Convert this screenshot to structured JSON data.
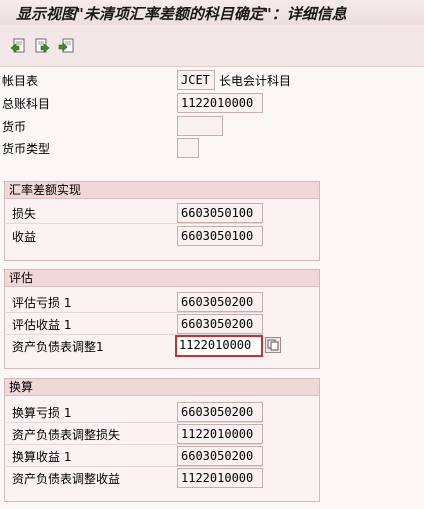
{
  "window": {
    "title": "显示视图\"未清项汇率差额的科目确定\"：详细信息"
  },
  "toolbar": {
    "buttons": [
      {
        "icon": "previous-entry-icon"
      },
      {
        "icon": "next-entry-icon"
      },
      {
        "icon": "other-entry-icon"
      }
    ]
  },
  "header": {
    "chart_of_accounts": {
      "label": "帐目表",
      "value": "JCET",
      "description": "长电会计科目"
    },
    "gl_account": {
      "label": "总账科目",
      "value": "1122010000"
    },
    "currency": {
      "label": "货币",
      "value": ""
    },
    "currency_type": {
      "label": "货币类型",
      "value": ""
    }
  },
  "realized": {
    "title": "汇率差额实现",
    "loss": {
      "label": "损失",
      "value": "6603050100"
    },
    "gain": {
      "label": "收益",
      "value": "6603050100"
    }
  },
  "valuation": {
    "title": "评估",
    "loss1": {
      "label": "评估亏损 1",
      "value": "6603050200"
    },
    "gain1": {
      "label": "评估收益 1",
      "value": "6603050200"
    },
    "bs_adj1": {
      "label": "资产负债表调整1",
      "value": "1122010000"
    }
  },
  "translation": {
    "title": "换算",
    "loss1": {
      "label": "换算亏损 1",
      "value": "6603050200"
    },
    "bs_adj_loss": {
      "label": "资产负债表调整损失",
      "value": "1122010000"
    },
    "gain1": {
      "label": "换算收益 1",
      "value": "6603050200"
    },
    "bs_adj_gain": {
      "label": "资产负债表调整收益",
      "value": "1122010000"
    }
  },
  "colors": {
    "background": "#fbf7f7",
    "group_header": "#f0d8d8",
    "active_border": "#c83030",
    "icon_green": "#3a8a3a"
  }
}
